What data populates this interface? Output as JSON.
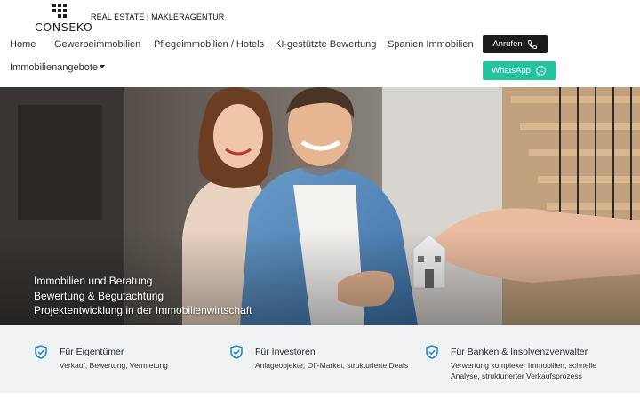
{
  "header": {
    "logo_text": "CONSEKO",
    "tagline": "REAL ESTATE | MAKLERAGENTUR",
    "call_label": "Anrufen",
    "whatsapp_label": "WhatsApp",
    "call_icon": "phone-icon",
    "whatsapp_icon": "whatsapp-icon"
  },
  "nav": {
    "items": [
      {
        "label": "Home"
      },
      {
        "label": "Gewerbeimmobilien"
      },
      {
        "label": "Pflegeimmobilien / Hotels"
      },
      {
        "label": "KI-gestützte Bewertung"
      },
      {
        "label": "Spanien Immobilien"
      }
    ],
    "dropdown_label": "Immobilienangebote"
  },
  "hero": {
    "lines": [
      "Immobilien und Beratung",
      "Bewertung & Begutachtung",
      "Projektentwicklung in der Immobilienwirtschaft"
    ]
  },
  "features": [
    {
      "title": "Für Eigentümer",
      "desc": [
        "Verkauf, Bewertung, Vermietung"
      ],
      "icon": "shield-check-icon"
    },
    {
      "title": "Für Investoren",
      "desc": [
        "Anlageobjekte, Off-Market, strukturierte Deals"
      ],
      "icon": "shield-check-icon"
    },
    {
      "title": "Für Banken & Insolvenzverwalter",
      "desc": [
        "Verwertung komplexer Immobilien, schnelle",
        "Analyse, strukturierter Verkaufsprozess"
      ],
      "icon": "shield-check-icon"
    }
  ],
  "colors": {
    "call_button": "#1c1c1c",
    "whatsapp_button": "#25c2a0",
    "feature_icon": "#1e8fd6",
    "feature_bar": "#f1f2f4"
  }
}
